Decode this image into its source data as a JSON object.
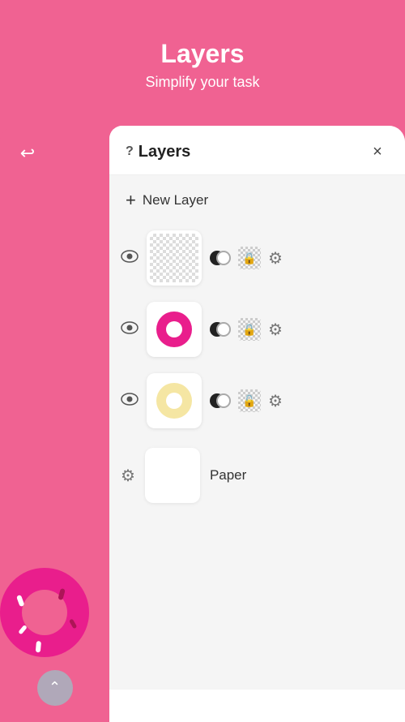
{
  "header": {
    "title": "Layers",
    "subtitle": "Simplify your task"
  },
  "panel": {
    "title": "Layers",
    "help_label": "?",
    "close_label": "×",
    "new_layer_label": "New Layer",
    "plus_icon": "+",
    "layers": [
      {
        "id": "layer1",
        "type": "dots",
        "visible": true
      },
      {
        "id": "layer2",
        "type": "donut_pink",
        "visible": true
      },
      {
        "id": "layer3",
        "type": "donut_yellow",
        "visible": true
      }
    ],
    "paper": {
      "label": "Paper"
    }
  },
  "canvas": {
    "back_icon": "←"
  }
}
